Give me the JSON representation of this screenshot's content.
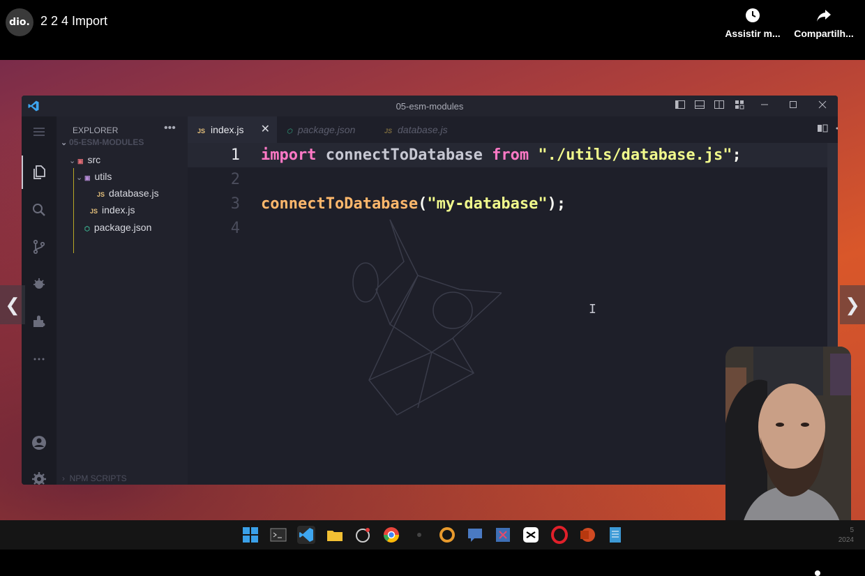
{
  "player": {
    "channel_logo": "dio.",
    "title": "2 2 4 Import",
    "actions": [
      {
        "label": "Assistir m...",
        "icon": "clock-icon"
      },
      {
        "label": "Compartilh...",
        "icon": "share-icon"
      }
    ],
    "prev_icon": "chevron-left-icon",
    "next_icon": "chevron-right-icon"
  },
  "vscode": {
    "window_title": "05-esm-modules",
    "explorer": {
      "header": "EXPLORER",
      "more": "•••",
      "root": "05-ESM-MODULES",
      "items": [
        {
          "label": "src",
          "type": "folder"
        },
        {
          "label": "utils",
          "type": "folder"
        },
        {
          "label": "database.js",
          "type": "js"
        },
        {
          "label": "index.js",
          "type": "js"
        },
        {
          "label": "package.json",
          "type": "json"
        }
      ],
      "npm_scripts": "NPM SCRIPTS"
    },
    "tabs": [
      {
        "label": "index.js",
        "icon": "JS",
        "active": true
      },
      {
        "label": "package.json",
        "icon": "pkg",
        "active": false
      },
      {
        "label": "database.js",
        "icon": "JS",
        "active": false
      }
    ],
    "file_badge": "JS",
    "close_glyph": "✕",
    "code_lines": [
      {
        "num": "1",
        "current": true
      },
      {
        "num": "2",
        "current": false
      },
      {
        "num": "3",
        "current": false
      },
      {
        "num": "4",
        "current": false
      }
    ],
    "code": {
      "line1": {
        "kw1": "import",
        "id": "connectToDatabase",
        "kw2": "from",
        "str": "\"./utils/database.js\"",
        "end": ";"
      },
      "line3": {
        "fn": "connectToDatabase",
        "open": "(",
        "str": "\"my-database\"",
        "close": ");"
      }
    },
    "text_cursor": "I"
  },
  "taskbar": {
    "date_top": "5",
    "date_bottom": "2024"
  },
  "colors": {
    "keyword": "#ff79c6",
    "function": "#ffb86c",
    "string": "#f1fa8c",
    "editor_bg": "#1e1f29"
  }
}
